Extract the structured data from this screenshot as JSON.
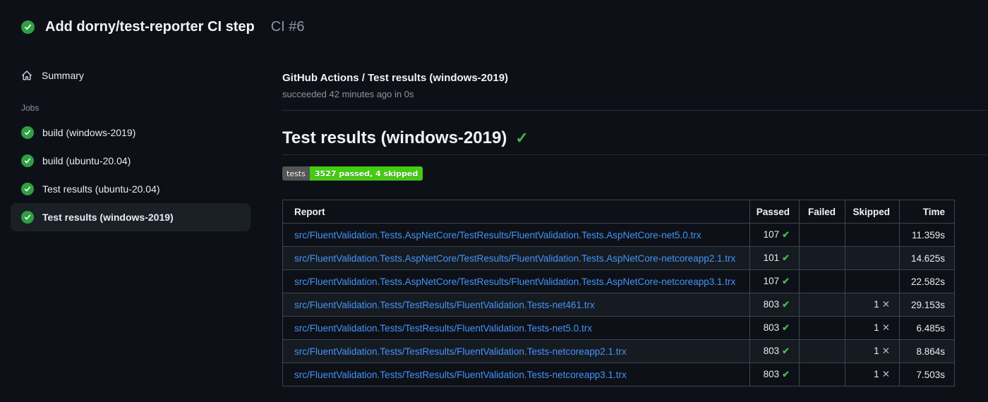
{
  "header": {
    "title": "Add dorny/test-reporter CI step",
    "run_label": "CI #6"
  },
  "sidebar": {
    "summary_label": "Summary",
    "jobs_label": "Jobs",
    "jobs": [
      {
        "label": "build (windows-2019)",
        "status": "success",
        "selected": false
      },
      {
        "label": "build (ubuntu-20.04)",
        "status": "success",
        "selected": false
      },
      {
        "label": "Test results (ubuntu-20.04)",
        "status": "success",
        "selected": false
      },
      {
        "label": "Test results (windows-2019)",
        "status": "success",
        "selected": true
      }
    ]
  },
  "main": {
    "check_header": {
      "title": "GitHub Actions / Test results (windows-2019)",
      "status_line": "succeeded 42 minutes ago in 0s"
    },
    "report": {
      "heading": "Test results (windows-2019)",
      "badge": {
        "label": "tests",
        "value": "3527 passed, 4 skipped",
        "label_bg": "#555555",
        "value_bg": "#44cc11"
      },
      "table": {
        "columns": [
          "Report",
          "Passed",
          "Failed",
          "Skipped",
          "Time"
        ],
        "rows": [
          {
            "report": "src/FluentValidation.Tests.AspNetCore/TestResults/FluentValidation.Tests.AspNetCore-net5.0.trx",
            "passed": "107",
            "failed": "",
            "skipped": "",
            "time": "11.359s"
          },
          {
            "report": "src/FluentValidation.Tests.AspNetCore/TestResults/FluentValidation.Tests.AspNetCore-netcoreapp2.1.trx",
            "passed": "101",
            "failed": "",
            "skipped": "",
            "time": "14.625s"
          },
          {
            "report": "src/FluentValidation.Tests.AspNetCore/TestResults/FluentValidation.Tests.AspNetCore-netcoreapp3.1.trx",
            "passed": "107",
            "failed": "",
            "skipped": "",
            "time": "22.582s"
          },
          {
            "report": "src/FluentValidation.Tests/TestResults/FluentValidation.Tests-net461.trx",
            "passed": "803",
            "failed": "",
            "skipped": "1",
            "time": "29.153s"
          },
          {
            "report": "src/FluentValidation.Tests/TestResults/FluentValidation.Tests-net5.0.trx",
            "passed": "803",
            "failed": "",
            "skipped": "1",
            "time": "6.485s"
          },
          {
            "report": "src/FluentValidation.Tests/TestResults/FluentValidation.Tests-netcoreapp2.1.trx",
            "passed": "803",
            "failed": "",
            "skipped": "1",
            "time": "8.864s"
          },
          {
            "report": "src/FluentValidation.Tests/TestResults/FluentValidation.Tests-netcoreapp3.1.trx",
            "passed": "803",
            "failed": "",
            "skipped": "1",
            "time": "7.503s"
          }
        ]
      }
    }
  },
  "icons": {
    "success_check": "success-check",
    "heading_check_glyph": "✓",
    "pass_check_glyph": "✔",
    "skip_cross_glyph": "✕"
  },
  "colors": {
    "page_bg": "#0d1117",
    "success_green": "#2ea043",
    "check_green": "#3fb950",
    "link_blue": "#4493f8",
    "table_border": "#3d444d",
    "row_alt_bg": "#161b22",
    "secondary_text": "#8b949e"
  }
}
